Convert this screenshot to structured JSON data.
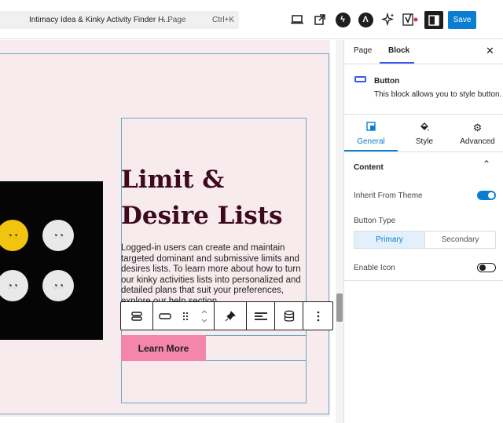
{
  "command_bar": {
    "title": "Intimacy Idea & Kinky Activity Finder H...",
    "type": "- Page",
    "shortcut": "Ctrl+K"
  },
  "toolbar": {
    "save_label": "Save"
  },
  "canvas": {
    "heading": "Limit & Desire Lists",
    "paragraph": "Logged-in users can create and maintain targeted dominant and submissive limits and desires lists. To learn more about how to turn our kinky activities lists into personalized and detailed plans that suit your preferences, explore our help section.",
    "button_label": "Learn More"
  },
  "sidebar": {
    "tabs": [
      "Page",
      "Block"
    ],
    "active_tab": "Block",
    "block_title": "Button",
    "block_desc": "This block allows you to style button.",
    "inspector_tabs": [
      "General",
      "Style",
      "Advanced"
    ],
    "active_inspector_tab": "General",
    "section_title": "Content",
    "inherit_label": "Inherit From Theme",
    "inherit_on": true,
    "button_type_label": "Button Type",
    "button_type_options": [
      "Primary",
      "Secondary"
    ],
    "button_type_selected": "Primary",
    "enable_icon_label": "Enable Icon",
    "enable_icon_on": false
  },
  "colors": {
    "accent": "#0a7fd1",
    "heading": "#3d0a1d",
    "canvas_bg": "#f8ebee",
    "button_bg": "#f486ab"
  }
}
